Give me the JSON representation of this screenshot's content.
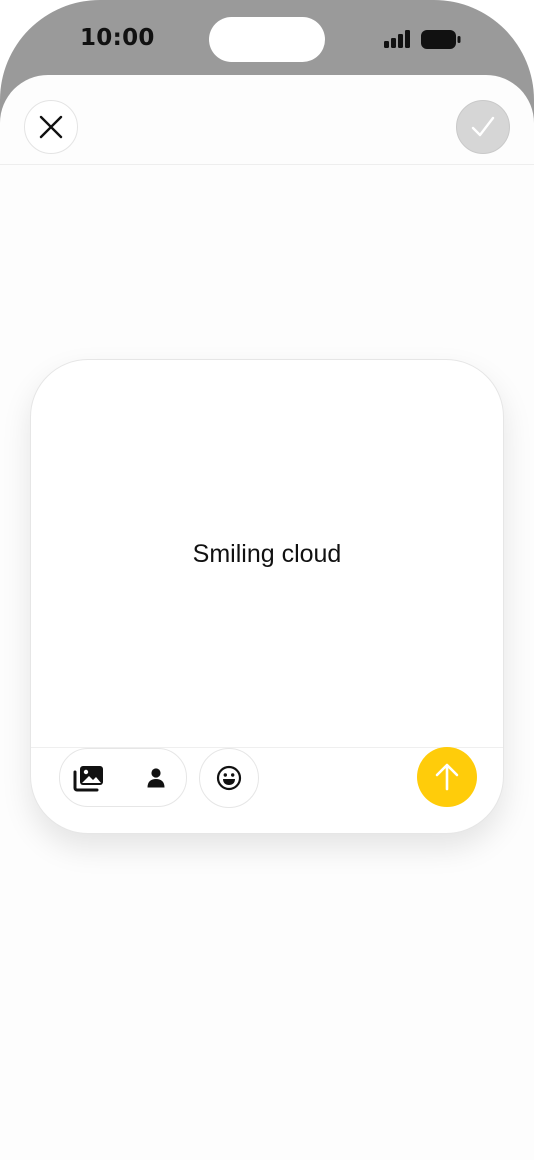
{
  "status_bar": {
    "time": "10:00"
  },
  "top_bar": {
    "close_icon": "close-icon",
    "confirm_icon": "checkmark-icon"
  },
  "card": {
    "text": "Smiling cloud",
    "toolbar": {
      "icons": [
        "photo-gallery-icon",
        "person-icon",
        "emoji-icon",
        "arrow-up-icon"
      ]
    }
  },
  "colors": {
    "send_button": "#ffcc0a",
    "confirm_button_disabled": "#d6d6d6",
    "status_bar_background": "#9a9a9a"
  }
}
